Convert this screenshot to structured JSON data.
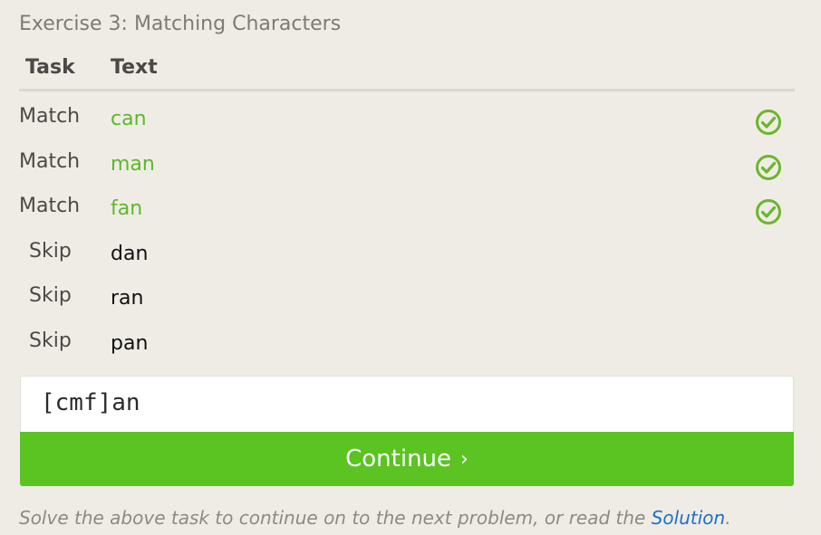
{
  "exercise": {
    "title": "Exercise 3: Matching Characters"
  },
  "table": {
    "headers": {
      "task": "Task",
      "text": "Text"
    },
    "rows": [
      {
        "task": "Match",
        "text": "can",
        "matched": true
      },
      {
        "task": "Match",
        "text": "man",
        "matched": true
      },
      {
        "task": "Match",
        "text": "fan",
        "matched": true
      },
      {
        "task": "Skip",
        "text": "dan",
        "matched": false
      },
      {
        "task": "Skip",
        "text": "ran",
        "matched": false
      },
      {
        "task": "Skip",
        "text": "pan",
        "matched": false
      }
    ]
  },
  "input": {
    "value": "[cmf]an"
  },
  "continue_button": {
    "label": "Continue",
    "arrow": "›"
  },
  "footer": {
    "text_before": "Solve the above task to continue on to the next problem, or read the ",
    "link_label": "Solution",
    "text_after": "."
  },
  "icons": {
    "row_status": "check-circle-icon"
  },
  "colors": {
    "background": "#efece5",
    "match_green": "#5cb82a",
    "check_green": "#6cb52d",
    "button_green": "#5bc322",
    "link_blue": "#1f6fc6"
  }
}
